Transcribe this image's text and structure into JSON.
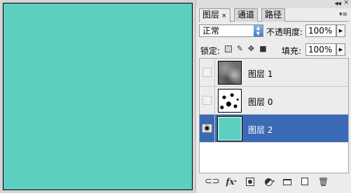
{
  "canvas": {
    "fill_color": "#5ccfc0"
  },
  "panel": {
    "tabs": [
      {
        "label": "图层",
        "close": "×"
      },
      {
        "label": "通道"
      },
      {
        "label": "路径"
      }
    ],
    "blend_mode": "正常",
    "opacity_label": "不透明度:",
    "opacity_value": "100%",
    "lock_label": "锁定:",
    "fill_label": "填充:",
    "fill_value": "100%",
    "layers": [
      {
        "name": "图层 1",
        "thumbnail": "clouds",
        "visible": false,
        "selected": false
      },
      {
        "name": "图层 0",
        "thumbnail": "pattern",
        "visible": false,
        "selected": false
      },
      {
        "name": "图层 2",
        "thumbnail": "teal-fill",
        "visible": true,
        "selected": true
      }
    ],
    "selection_color": "#3a6ab5",
    "bottom_icons": [
      "link-icon",
      "fx-icon",
      "mask-icon",
      "adjustment-icon",
      "group-folder-icon",
      "new-layer-icon",
      "trash-icon"
    ]
  }
}
